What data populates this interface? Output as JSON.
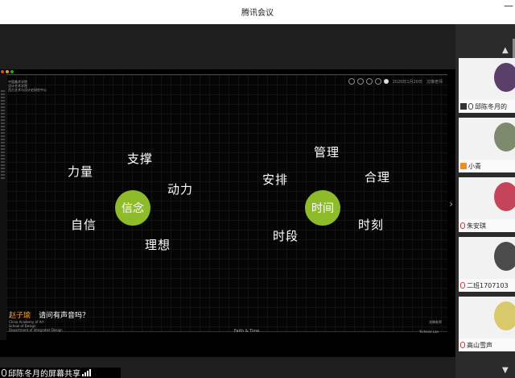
{
  "window": {
    "title": "腾讯会议",
    "minimize_glyph": "—"
  },
  "slide": {
    "top_left_text": "中国美术学院\n设计艺术学院\n西方艺术与设计史研究中心",
    "toolbar_date": "2020年1月20日",
    "toolbar_date_extra": "沈琳老师",
    "left_group": {
      "center": "信念",
      "words": [
        "力量",
        "支撑",
        "动力",
        "自信",
        "理想"
      ]
    },
    "right_group": {
      "center": "时间",
      "words": [
        "管理",
        "安排",
        "合理",
        "时段",
        "时刻"
      ]
    },
    "footer_left": "China Academy of Art\nSchool of Design\nDepartment of Integrated Design",
    "footer_mid": "Faith & Time",
    "footer_right_top": "沈琳老师",
    "footer_right": "Yichana Lan",
    "accent_color": "#8dbb2a"
  },
  "caption": {
    "speaker": "赵子瑜",
    "text": "请问有声音吗？"
  },
  "share_status": {
    "label": "邱陈冬月的屏幕共享",
    "icon": "mic-icon",
    "signal_icon": "signal-bars-icon"
  },
  "participants": [
    {
      "name": "邱陈冬月的",
      "icons": [
        "screen-share-icon",
        "mic-icon"
      ]
    },
    {
      "name": "小青",
      "icons": [
        "user-icon"
      ]
    },
    {
      "name": "朱安琪",
      "icons": [
        "mic-off-icon"
      ]
    },
    {
      "name": "二班1707103",
      "icons": [
        "mic-off-icon"
      ]
    },
    {
      "name": "高山雪声",
      "icons": [
        "mic-off-icon"
      ]
    }
  ],
  "nav": {
    "up_glyph": "▲",
    "down_glyph": "▼",
    "next_glyph": "›"
  }
}
